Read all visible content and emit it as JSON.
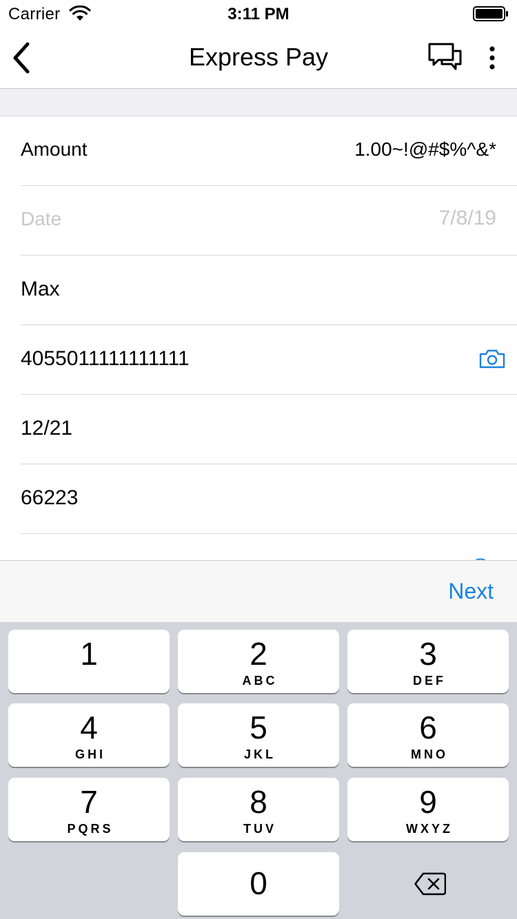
{
  "status_bar": {
    "carrier": "Carrier",
    "time": "3:11 PM",
    "wifi_icon": "wifi-icon",
    "battery_icon": "battery-icon"
  },
  "nav": {
    "back_icon": "chevron-left-icon",
    "title": "Express Pay",
    "chat_icon": "chat-bubbles-icon",
    "more_icon": "more-vertical-icon"
  },
  "form": {
    "amount": {
      "label": "Amount",
      "value": "1.00~!@#$%^&*"
    },
    "date": {
      "label": "Date",
      "value": "7/8/19"
    },
    "name": {
      "value": "Max"
    },
    "card_number": {
      "value": "4055011111111111",
      "scan_icon": "camera-icon"
    },
    "expiry": {
      "value": "12/21"
    },
    "zip": {
      "value": "66223"
    }
  },
  "accessory": {
    "next_label": "Next"
  },
  "keypad": {
    "keys": [
      {
        "digit": "1",
        "letters": ""
      },
      {
        "digit": "2",
        "letters": "ABC"
      },
      {
        "digit": "3",
        "letters": "DEF"
      },
      {
        "digit": "4",
        "letters": "GHI"
      },
      {
        "digit": "5",
        "letters": "JKL"
      },
      {
        "digit": "6",
        "letters": "MNO"
      },
      {
        "digit": "7",
        "letters": "PQRS"
      },
      {
        "digit": "8",
        "letters": "TUV"
      },
      {
        "digit": "9",
        "letters": "WXYZ"
      },
      {
        "digit": "0",
        "letters": ""
      }
    ],
    "delete_icon": "backspace-icon"
  },
  "colors": {
    "accent": "#1a82e2",
    "placeholder": "#c7c7cd",
    "keypad_bg": "#d1d4da"
  }
}
